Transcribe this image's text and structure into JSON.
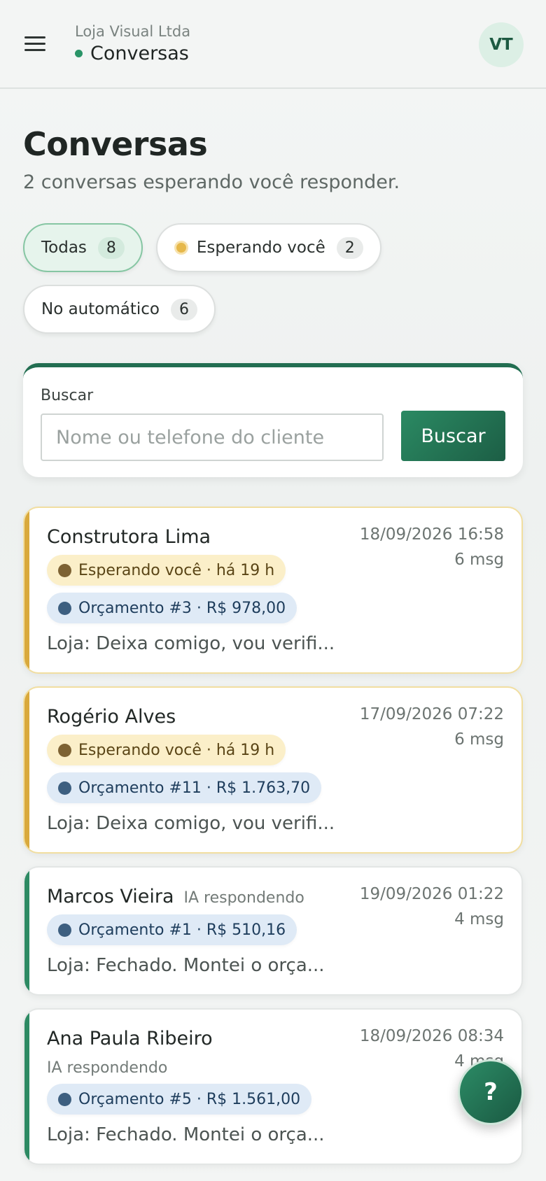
{
  "header": {
    "org_name": "Loja Visual Ltda",
    "section": "Conversas",
    "avatar_initials": "VT"
  },
  "page": {
    "title": "Conversas",
    "subtitle": "2 conversas esperando você responder."
  },
  "filters": [
    {
      "label": "Todas",
      "count": "8",
      "active": true
    },
    {
      "label": "Esperando você",
      "count": "2",
      "active": false
    },
    {
      "label": "No automático",
      "count": "6",
      "active": false
    }
  ],
  "search": {
    "label": "Buscar",
    "placeholder": "Nome ou telefone do cliente",
    "button": "Buscar"
  },
  "conversations": [
    {
      "name": "Construtora Lima",
      "status": "waiting",
      "date": "18/09/2026 16:58",
      "messages": "6 msg",
      "wait_badge": "Esperando você · há 19 h",
      "quote_badge": "Orçamento #3 · R$ 978,00",
      "preview": "Loja: Deixa comigo, vou verifi..."
    },
    {
      "name": "Rogério Alves",
      "status": "waiting",
      "date": "17/09/2026 07:22",
      "messages": "6 msg",
      "wait_badge": "Esperando você · há 19 h",
      "quote_badge": "Orçamento #11 · R$ 1.763,70",
      "preview": "Loja: Deixa comigo, vou verifi..."
    },
    {
      "name": "Marcos Vieira",
      "status": "ai",
      "ai_label": "IA respondendo",
      "date": "19/09/2026 01:22",
      "messages": "4 msg",
      "quote_badge": "Orçamento #1 · R$ 510,16",
      "preview": "Loja: Fechado. Montei o orça..."
    },
    {
      "name": "Ana Paula Ribeiro",
      "status": "ai",
      "ai_label": "IA respondendo",
      "date": "18/09/2026 08:34",
      "messages": "4 msg",
      "quote_badge": "Orçamento #5 · R$ 1.561,00",
      "preview": "Loja: Fechado. Montei o orça..."
    }
  ],
  "help": {
    "label": "?"
  },
  "colors": {
    "brand": "#226e51",
    "waiting_accent": "#d9a93c",
    "waiting_badge_bg": "#fbefc9",
    "quote_badge_bg": "#dfeaf6"
  },
  "icons": {
    "menu": "menu-icon",
    "status": "online-dot-icon"
  }
}
